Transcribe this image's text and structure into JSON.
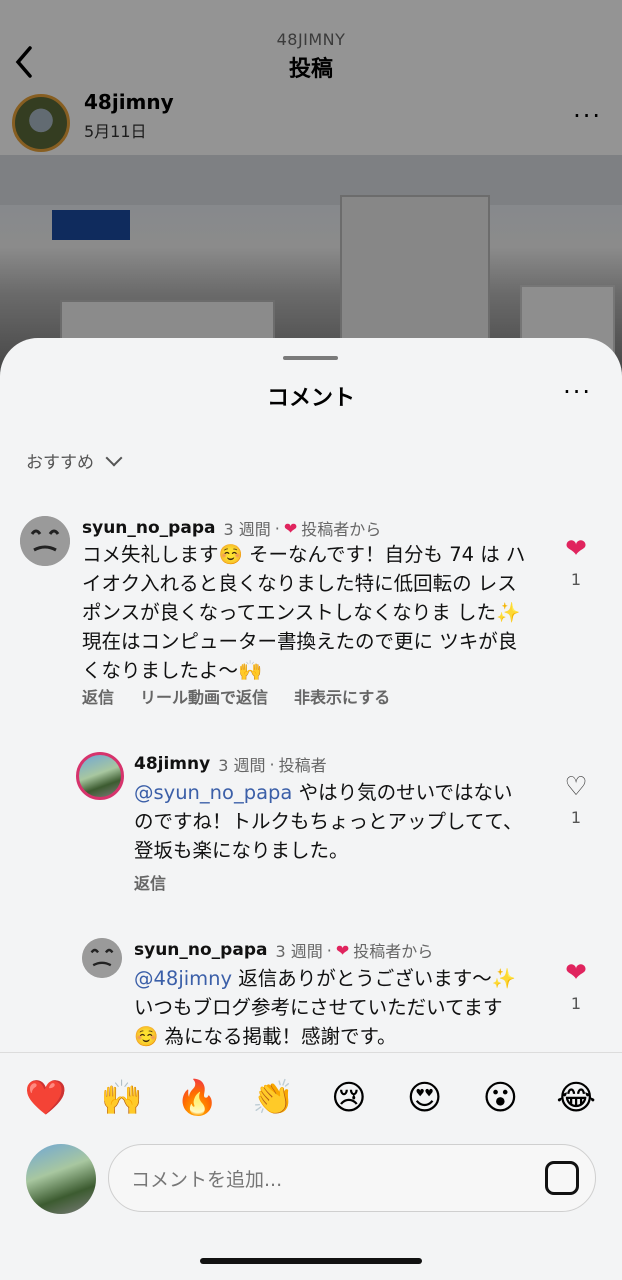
{
  "nav": {
    "subtitle": "48JIMNY",
    "title": "投稿"
  },
  "post": {
    "username": "48jimny",
    "date": "5月11日",
    "more": "···"
  },
  "sheet": {
    "title": "コメント",
    "more": "···",
    "sort_label": "おすすめ"
  },
  "comments": [
    {
      "username": "syun_no_papa",
      "time": "3 週間",
      "from_author": "投稿者から",
      "text": "コメ失礼します☺️ そーなんです！自分も 74 は ハイオク入れると良くなりました特に低回転の レスポンスが良くなってエンストしなくなりま した✨ 現在はコンピューター書換えたので更に ツキが良くなりましたよ〜🙌",
      "actions": [
        "返信",
        "リール動画で返信",
        "非表示にする"
      ],
      "likes": "1",
      "liked": true
    },
    {
      "username": "48jimny",
      "time": "3 週間",
      "role": "投稿者",
      "mention": "@syun_no_papa",
      "text": " やはり気のせいではないのですね！トルクもちょっとアップしてて、登坂も楽になりました。",
      "actions": [
        "返信"
      ],
      "likes": "1",
      "liked": false
    },
    {
      "username": "syun_no_papa",
      "time": "3 週間",
      "from_author": "投稿者から",
      "mention": "@48jimny",
      "text": " 返信ありがとうございます〜✨ いつもブログ参考にさせていただいてます☺️ 為になる掲載！感謝です。",
      "likes": "1",
      "liked": true
    }
  ],
  "emoji_bar": [
    "❤️",
    "🙌",
    "🔥",
    "👏",
    "😢",
    "😍",
    "😮",
    "😂"
  ],
  "input": {
    "placeholder": "コメントを追加..."
  },
  "icons": {
    "heart": "heart-icon",
    "back": "chevron-left-icon",
    "sticker": "sticker-icon"
  },
  "colors": {
    "like_red": "#e0245e",
    "mention": "#3b5fa8",
    "story_ring": "#e8a33a"
  }
}
